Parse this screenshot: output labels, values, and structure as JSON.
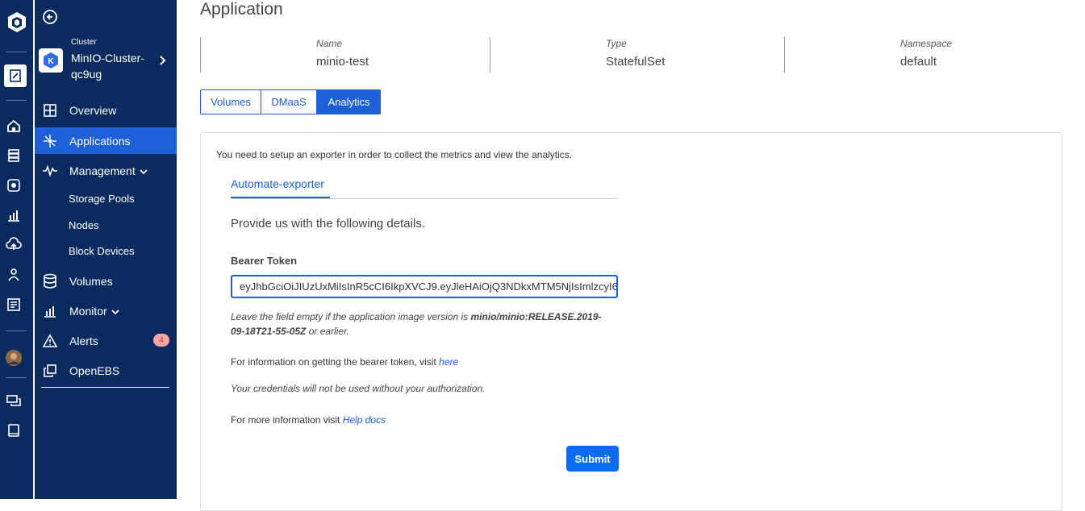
{
  "rail": {
    "logo_icon": "maya-logo-icon",
    "items": [
      "projects-icon",
      "home-icon",
      "clusters-icon",
      "apps-icon",
      "analytics-icon",
      "cloud-icon",
      "user-icon",
      "report-icon",
      "chat-icon",
      "docs-icon"
    ]
  },
  "sidebar": {
    "back_icon": "back-arrow-icon",
    "cluster_label": "Cluster",
    "cluster_name": "MinIO-Cluster-qc9ug",
    "items": [
      {
        "label": "Overview",
        "icon": "grid-icon"
      },
      {
        "label": "Applications",
        "icon": "applications-icon"
      },
      {
        "label": "Management",
        "icon": "pulse-icon"
      },
      {
        "label": "Storage Pools"
      },
      {
        "label": "Nodes"
      },
      {
        "label": "Block Devices"
      },
      {
        "label": "Volumes",
        "icon": "database-icon"
      },
      {
        "label": "Monitor",
        "icon": "chart-icon"
      },
      {
        "label": "Alerts",
        "icon": "warning-icon",
        "badge": "4"
      },
      {
        "label": "OpenEBS",
        "icon": "copy-icon"
      }
    ]
  },
  "main": {
    "title": "Application",
    "meta": [
      {
        "label": "Name",
        "value": "minio-test"
      },
      {
        "label": "Type",
        "value": "StatefulSet"
      },
      {
        "label": "Namespace",
        "value": "default"
      }
    ],
    "tabs": [
      "Volumes",
      "DMaaS",
      "Analytics"
    ],
    "selected_tab": "Analytics",
    "card": {
      "intro": "You need to setup an exporter in order to collect the metrics and view the analytics.",
      "subtab": "Automate-exporter",
      "heading": "Provide us with the following details.",
      "token_label": "Bearer Token",
      "token_value": "eyJhbGciOiJIUzUxMiIsInR5cCI6IkpXVCJ9.eyJleHAiOjQ3NDkxMTM5NjIsImlzcyI6",
      "note_pre": "Leave the field empty if the application image version is ",
      "note_bold": "minio/minio:RELEASE.2019-09-18T21-55-05Z",
      "note_post": " or earlier.",
      "info_pre": "For information on getting the bearer token, visit ",
      "info_link": "here",
      "credentials": "Your credentials will not be used without your authorization.",
      "more_pre": "For more information visit ",
      "more_link": "Help docs",
      "submit": "Submit"
    }
  },
  "colors": {
    "sidebar": "#0b2b5f",
    "accent": "#1c5fd6",
    "badge": "#f4a6a6"
  }
}
